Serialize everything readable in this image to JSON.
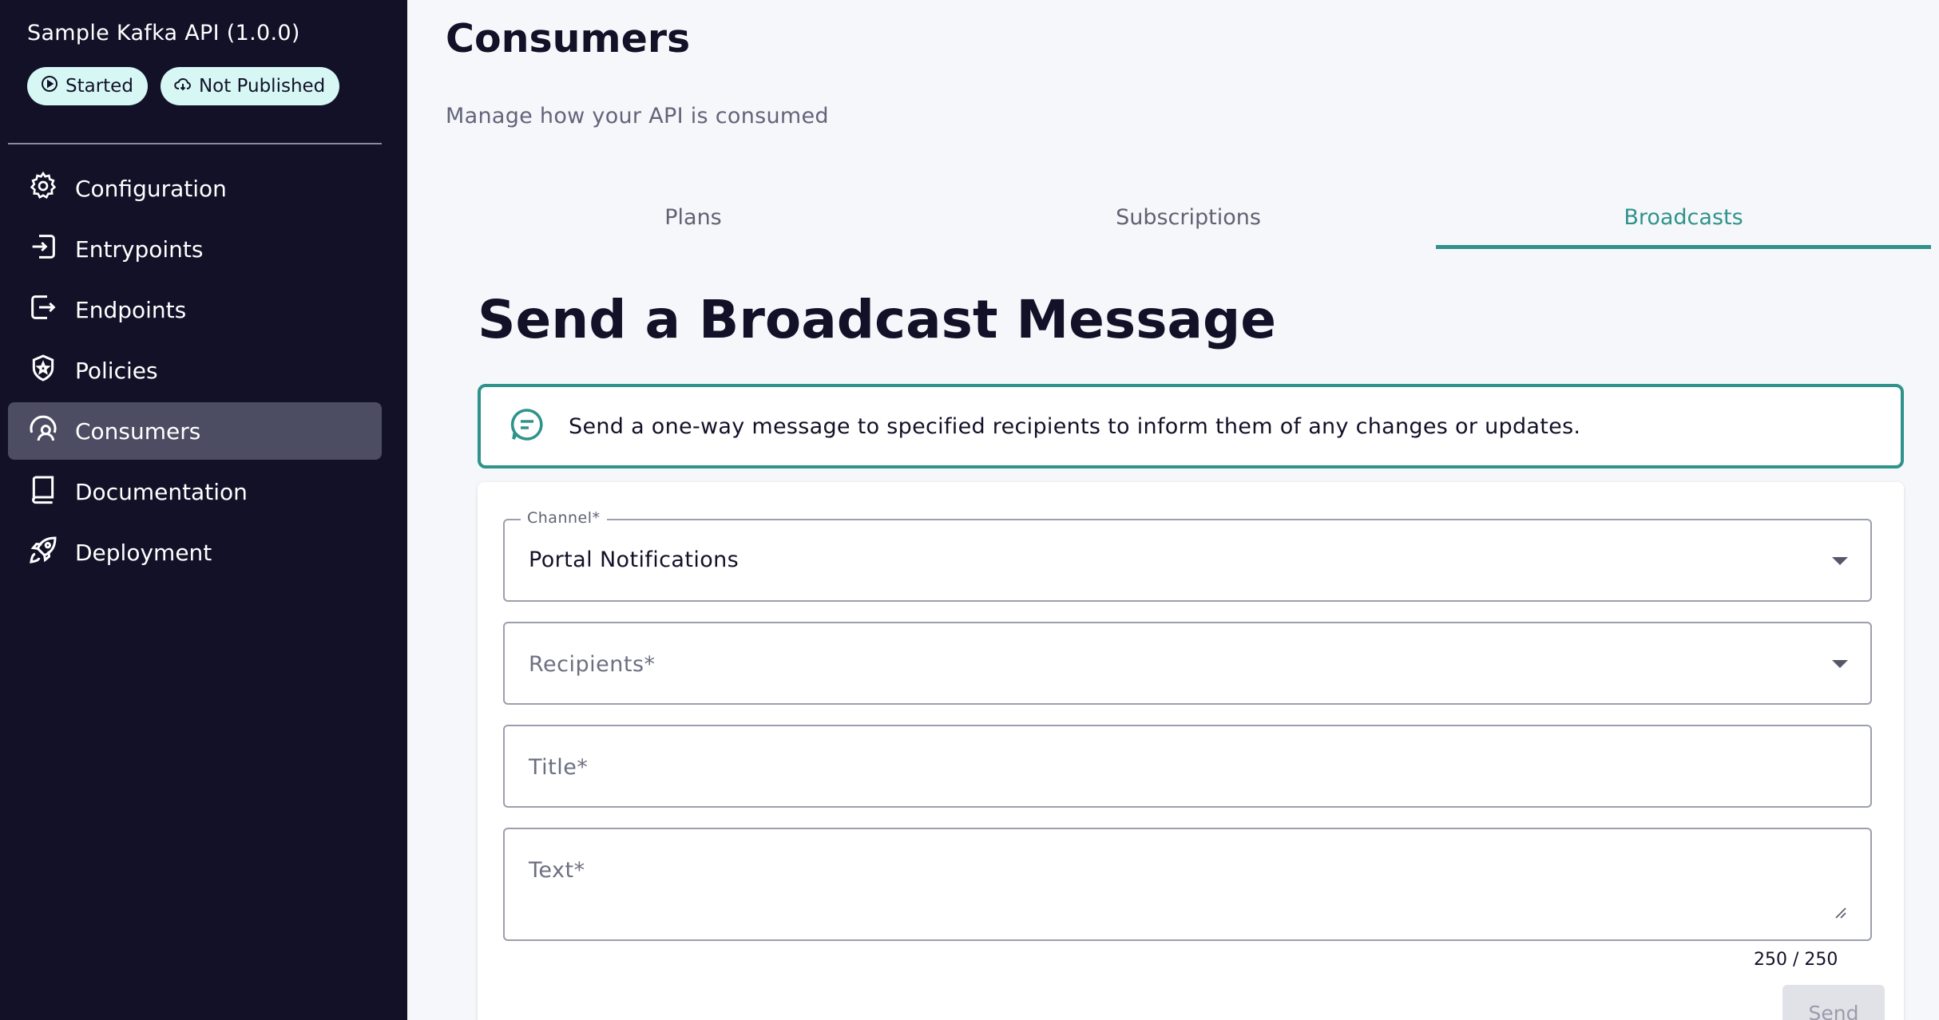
{
  "sidebar": {
    "api_title": "Sample Kafka API (1.0.0)",
    "badges": [
      {
        "label": "Started",
        "icon": "play-circle-icon"
      },
      {
        "label": "Not Published",
        "icon": "cloud-off-icon"
      }
    ],
    "items": [
      {
        "label": "Configuration",
        "icon": "gear-icon",
        "active": false
      },
      {
        "label": "Entrypoints",
        "icon": "entrypoint-icon",
        "active": false
      },
      {
        "label": "Endpoints",
        "icon": "endpoint-icon",
        "active": false
      },
      {
        "label": "Policies",
        "icon": "shield-icon",
        "active": false
      },
      {
        "label": "Consumers",
        "icon": "users-icon",
        "active": true
      },
      {
        "label": "Documentation",
        "icon": "book-icon",
        "active": false
      },
      {
        "label": "Deployment",
        "icon": "rocket-icon",
        "active": false
      }
    ]
  },
  "header": {
    "title": "Consumers",
    "subtitle": "Manage how your API is consumed"
  },
  "tabs": [
    {
      "label": "Plans",
      "active": false
    },
    {
      "label": "Subscriptions",
      "active": false
    },
    {
      "label": "Broadcasts",
      "active": true
    }
  ],
  "broadcast": {
    "title": "Send a Broadcast Message",
    "info_text": "Send a one-way message to specified recipients to inform them of any changes or updates.",
    "channel": {
      "label": "Channel*",
      "value": "Portal Notifications"
    },
    "recipients": {
      "placeholder": "Recipients*"
    },
    "title_field": {
      "placeholder": "Title*"
    },
    "text_field": {
      "placeholder": "Text*"
    },
    "counter": "250 / 250",
    "send_label": "Send"
  },
  "colors": {
    "sidebar_bg": "#121128",
    "accent": "#2f938b",
    "badge_bg": "#d6f7f4",
    "active_nav_bg": "#4c4d62"
  }
}
